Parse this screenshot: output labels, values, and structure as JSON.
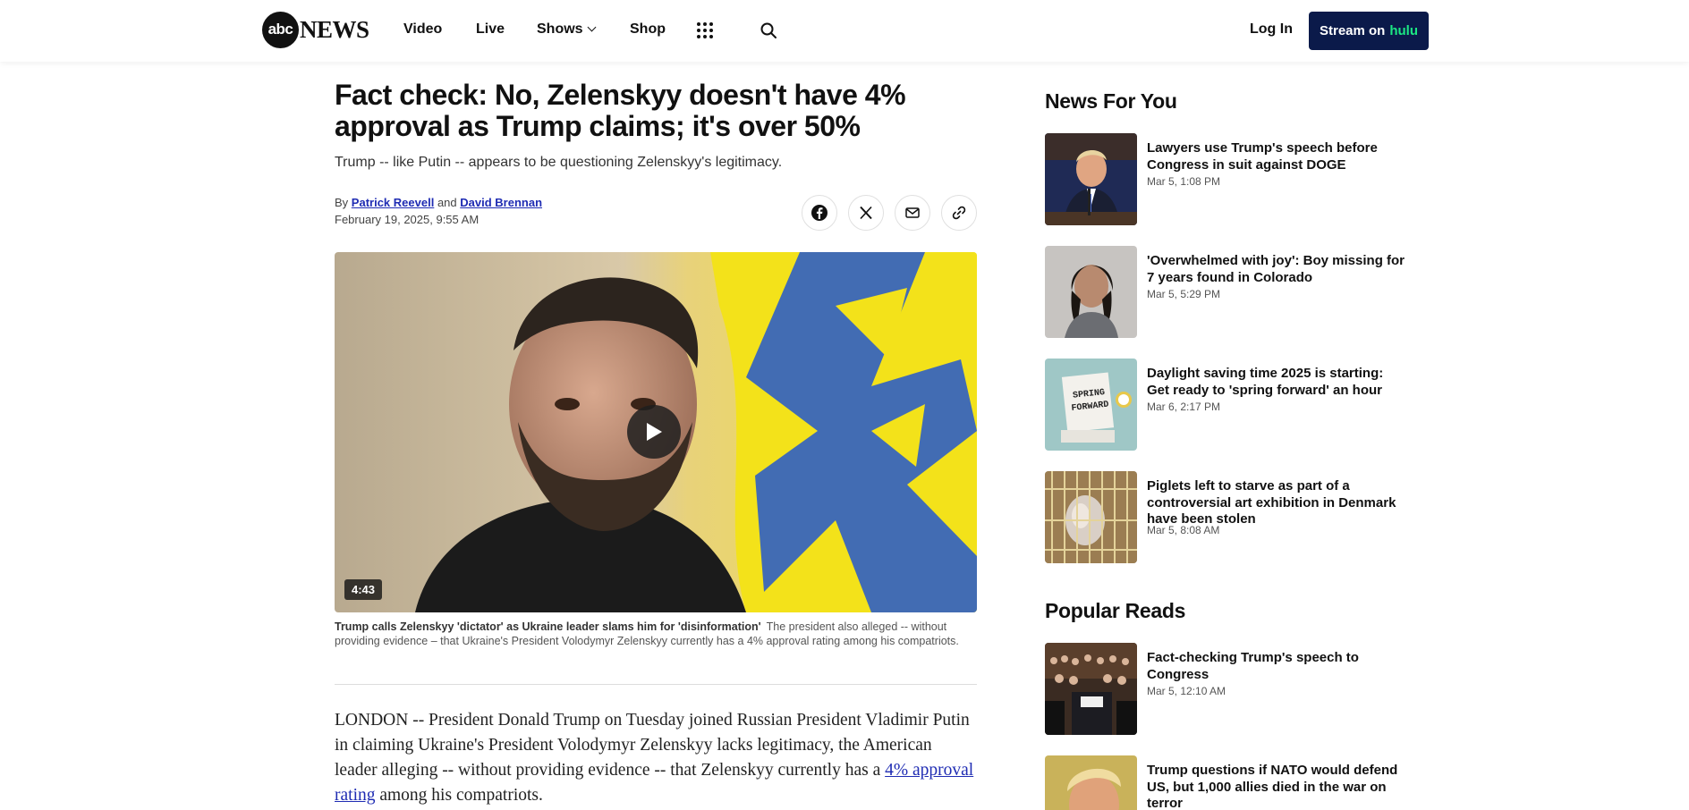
{
  "header": {
    "logo_abc": "abc",
    "logo_news": "NEWS",
    "nav": [
      {
        "label": "Video"
      },
      {
        "label": "Live"
      },
      {
        "label": "Shows"
      },
      {
        "label": "Shop"
      }
    ],
    "login_label": "Log In",
    "stream_label": "Stream on",
    "stream_brand": "hulu",
    "colors": {
      "stream_bg": "#0b1a4a",
      "hulu_green": "#1ce783"
    }
  },
  "article": {
    "headline": "Fact check: No, Zelenskyy doesn't have 4% approval as Trump claims; it's over 50%",
    "dek": "Trump -- like Putin -- appears to be questioning Zelenskyy's legitimacy.",
    "byline_prefix": "By",
    "author1": "Patrick Reevell",
    "byline_and": "and",
    "author2": "David Brennan",
    "date": "February 19, 2025, 9:55 AM",
    "video_duration": "4:43",
    "caption_title": "Trump calls Zelenskyy 'dictator' as Ukraine leader slams him for 'disinformation'",
    "caption_text": "The president also alleged -- without providing evidence – that Ukraine's President Volodymyr Zelenskyy currently has a 4% approval rating among his compatriots.",
    "body_intro": "LONDON -- President Donald Trump on Tuesday joined Russian President Vladimir Putin in claiming Ukraine's President Volodymyr Zelenskyy lacks legitimacy, the American leader alleging -- without providing evidence -- that Zelenskyy currently has a",
    "body_link": "4% approval rating",
    "body_end": "among his compatriots.",
    "link_color": "#1f2cb3"
  },
  "rail": {
    "news_for_you_heading": "News For You",
    "news_for_you": [
      {
        "title": "Lawyers use Trump's speech before Congress in suit against DOGE",
        "time": "Mar 5, 1:08 PM"
      },
      {
        "title": "'Overwhelmed with joy': Boy missing for 7 years found in Colorado",
        "time": "Mar 5, 5:29 PM"
      },
      {
        "title": "Daylight saving time 2025 is starting: Get ready to 'spring forward' an hour",
        "time": "Mar 6, 2:17 PM"
      },
      {
        "title": "Piglets left to starve as part of a controversial art exhibition in Denmark have been stolen",
        "time": "Mar 5, 8:08 AM"
      }
    ],
    "popular_heading": "Popular Reads",
    "popular": [
      {
        "title": "Fact-checking Trump's speech to Congress",
        "time": "Mar 5, 12:10 AM"
      },
      {
        "title": "Trump questions if NATO would defend US, but 1,000 allies died in the war on terror",
        "time": ""
      }
    ],
    "spring_forward_sign": [
      "SPRING",
      "FORWARD"
    ]
  }
}
